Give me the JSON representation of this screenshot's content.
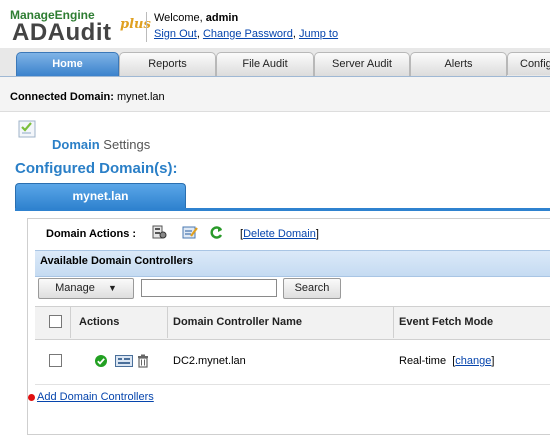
{
  "brand": {
    "company": "ManageEngine",
    "product": "ADAudit",
    "plus": "plus"
  },
  "header": {
    "welcome_prefix": "Welcome,",
    "user": "admin",
    "links": [
      "Sign Out",
      "Change Password",
      "Jump to"
    ]
  },
  "tabs": [
    {
      "label": "Home",
      "active": true
    },
    {
      "label": "Reports"
    },
    {
      "label": "File Audit"
    },
    {
      "label": "Server Audit"
    },
    {
      "label": "Alerts"
    },
    {
      "label": "Config"
    }
  ],
  "connected": {
    "label": "Connected Domain:",
    "value": "mynet.lan"
  },
  "page": {
    "title_accent": "Domain",
    "title_rest": "Settings",
    "configured_heading": "Configured Domain(s):"
  },
  "domain_tab": "mynet.lan",
  "domain_actions": {
    "label": "Domain Actions :",
    "delete_label": "Delete Domain",
    "bracket_open": "[",
    "bracket_close": "]"
  },
  "controllers": {
    "title": "Available Domain Controllers",
    "manage_label": "Manage",
    "search_value": "",
    "search_button": "Search",
    "columns": [
      "Actions",
      "Domain Controller Name",
      "Event Fetch Mode"
    ],
    "rows": [
      {
        "name": "DC2.mynet.lan",
        "fetch_mode": "Real-time",
        "change_label": "change"
      }
    ],
    "add_link": "Add Domain Controllers"
  },
  "colors": {
    "accent": "#2a7fc7",
    "tab_active": "#3b82cc",
    "link": "#0645ad",
    "status_ok": "#22a022"
  }
}
